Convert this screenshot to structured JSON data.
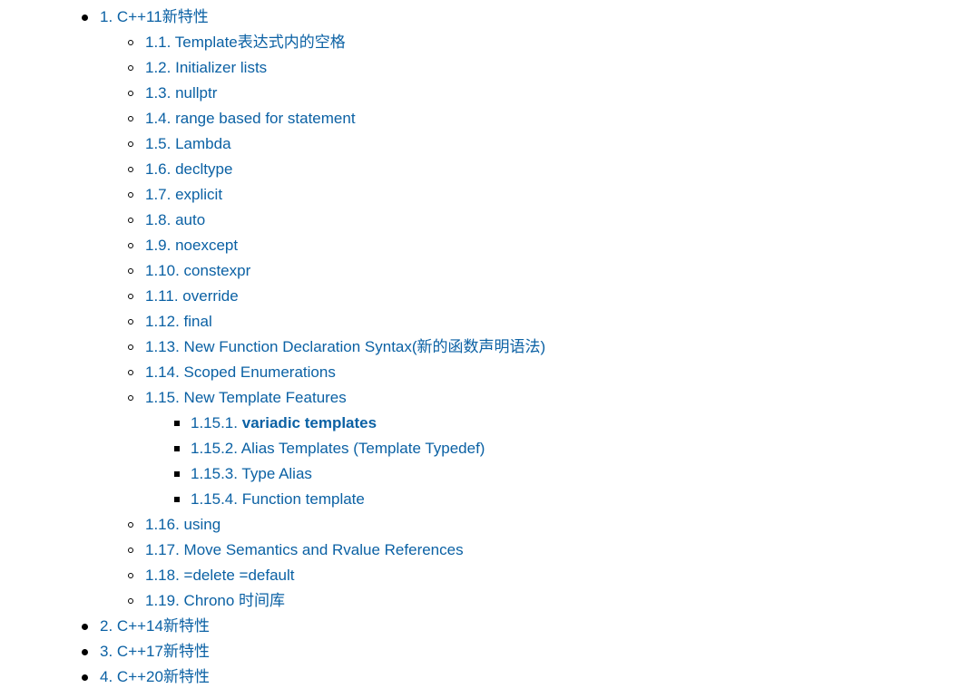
{
  "toc": [
    {
      "num": "1.",
      "title": "C++11新特性",
      "children": [
        {
          "num": "1.1.",
          "title": "Template表达式内的空格"
        },
        {
          "num": "1.2.",
          "title": "Initializer lists"
        },
        {
          "num": "1.3.",
          "title": "nullptr"
        },
        {
          "num": "1.4.",
          "title": "range based for statement"
        },
        {
          "num": "1.5.",
          "title": "Lambda"
        },
        {
          "num": "1.6.",
          "title": "decltype"
        },
        {
          "num": "1.7.",
          "title": "explicit"
        },
        {
          "num": "1.8.",
          "title": "auto"
        },
        {
          "num": "1.9.",
          "title": "noexcept"
        },
        {
          "num": "1.10.",
          "title": "constexpr"
        },
        {
          "num": "1.11.",
          "title": "override"
        },
        {
          "num": "1.12.",
          "title": "final"
        },
        {
          "num": "1.13.",
          "title": "New Function Declaration Syntax(新的函数声明语法)"
        },
        {
          "num": "1.14.",
          "title": "Scoped Enumerations"
        },
        {
          "num": "1.15.",
          "title": "New Template Features",
          "children": [
            {
              "num": "1.15.1.",
              "title": "variadic templates",
              "bold": true
            },
            {
              "num": "1.15.2.",
              "title": "Alias Templates (Template Typedef)"
            },
            {
              "num": "1.15.3.",
              "title": "Type Alias"
            },
            {
              "num": "1.15.4.",
              "title": "Function template"
            }
          ]
        },
        {
          "num": "1.16.",
          "title": "using"
        },
        {
          "num": "1.17.",
          "title": "Move Semantics and Rvalue References"
        },
        {
          "num": "1.18.",
          "title": "=delete =default"
        },
        {
          "num": "1.19.",
          "title": "Chrono 时间库"
        }
      ]
    },
    {
      "num": "2.",
      "title": "C++14新特性"
    },
    {
      "num": "3.",
      "title": "C++17新特性"
    },
    {
      "num": "4.",
      "title": "C++20新特性"
    }
  ],
  "colors": {
    "link": "#0b61a4",
    "marker": "#000000",
    "background": "#ffffff"
  }
}
